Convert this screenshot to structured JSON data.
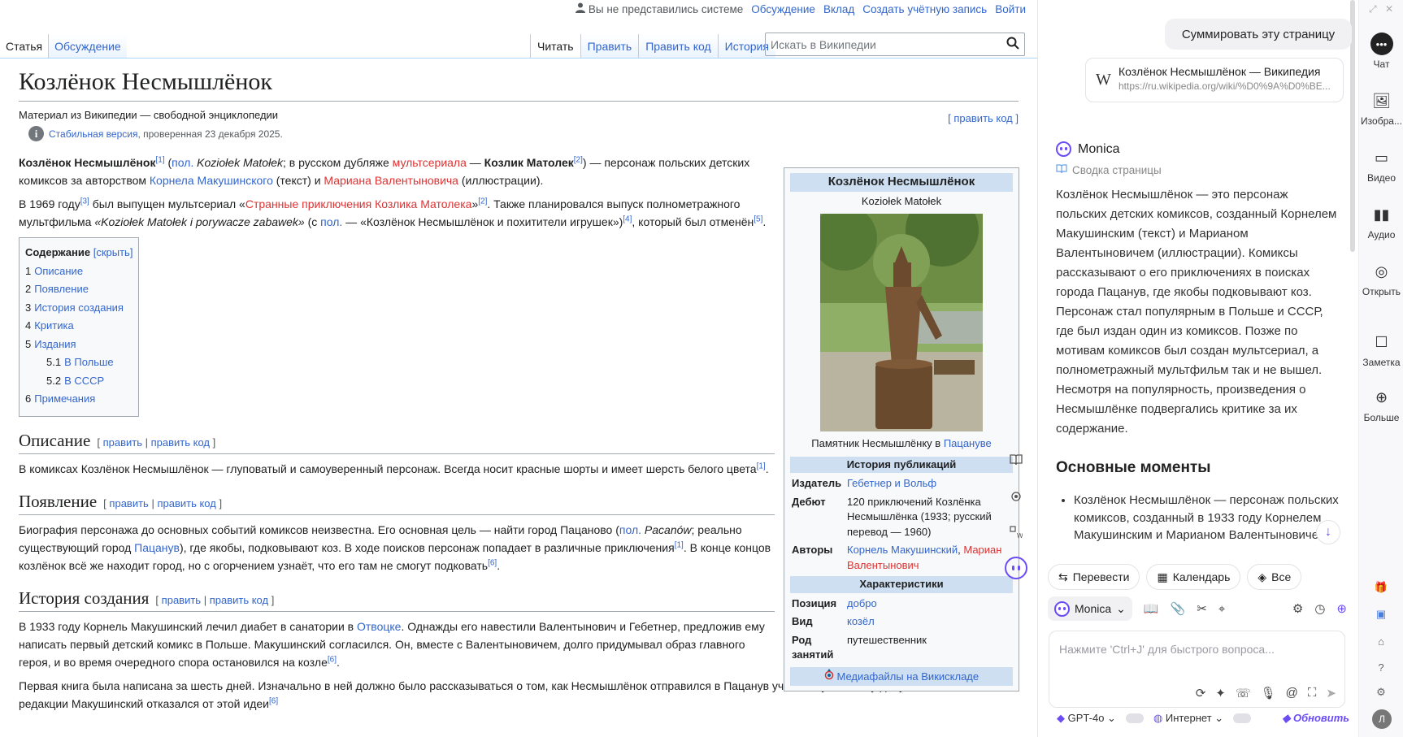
{
  "wiki": {
    "personal": {
      "anon": "Вы не представились системе",
      "talk": "Обсуждение",
      "contrib": "Вклад",
      "create": "Создать учётную запись",
      "login": "Войти"
    },
    "tabs_left": [
      "Статья",
      "Обсуждение"
    ],
    "tabs_right": [
      "Читать",
      "Править",
      "Править код",
      "История"
    ],
    "search_placeholder": "Искать в Википедии",
    "title": "Козлёнок Несмышлёнок",
    "tagline": "Материал из Википедии — свободной энциклопедии",
    "edit_code_top": "[ править код ]",
    "stable_link": "Стабильная версия",
    "stable_rest": ", проверенная 23 декабря 2025.",
    "lead1": {
      "bold1": "Козлёнок Несмышлёнок",
      "ref1": "[1]",
      "pl_link": "пол.",
      "pl_name": "Koziołek Matołek",
      "mid1": "; в русском дубляже ",
      "mult_link": "мультсериала",
      "dash": " — ",
      "bold2": "Козлик Матолек",
      "ref2": "[2]",
      "mid2": ") — персонаж польских детских комиксов за авторством ",
      "kornel": "Корнела Макушинского",
      "mid3": " (текст) и ",
      "marian": "Мариана Валентыновича",
      "end": " (иллюстрации)."
    },
    "lead2": {
      "a": "В 1969 году",
      "ref3": "[3]",
      "b": " был выпущен мультсериал «",
      "serial_link": "Странные приключения Козлика Матолека",
      "c": "»",
      "ref2": "[2]",
      "d": ". Также планировался выпуск полнометражного мультфильма ",
      "film": "«Koziołek Matołek i porywacze zabawek»",
      "e": " (с ",
      "pl": "пол.",
      "f": " — «Козлёнок Несмышлёнок и похитители игрушек»)",
      "ref4": "[4]",
      "g": ", который был отменён",
      "ref5": "[5]",
      "h": "."
    },
    "toc": {
      "title": "Содержание",
      "hide": "[скрыть]",
      "items": [
        {
          "n": "1",
          "label": "Описание"
        },
        {
          "n": "2",
          "label": "Появление"
        },
        {
          "n": "3",
          "label": "История создания"
        },
        {
          "n": "4",
          "label": "Критика"
        },
        {
          "n": "5",
          "label": "Издания"
        },
        {
          "n": "5.1",
          "label": "В Польше"
        },
        {
          "n": "5.2",
          "label": "В СССР"
        },
        {
          "n": "6",
          "label": "Примечания"
        }
      ]
    },
    "section_edit": {
      "open": "[",
      "edit": "править",
      "sep": "|",
      "code": "править код",
      "close": "]"
    },
    "s1": {
      "title": "Описание",
      "text": "В комиксах Козлёнок Несмышлёнок — глуповатый и самоуверенный персонаж. Всегда носит красные шорты и имеет шерсть белого цвета",
      "ref": "[1]",
      "end": "."
    },
    "s2": {
      "title": "Появление",
      "a": "Биография персонажа до основных событий комиксов неизвестна. Его основная цель — найти город Пацаново (",
      "pl": "пол.",
      "pl_name": "Pacanów",
      "b": "; реально существующий город ",
      "city": "Пацанув",
      "c": "), где якобы, подковывают коз. В ходе поисков персонаж попадает в различные приключения",
      "ref1": "[1]",
      "d": ". В конце концов козлёнок всё же находит город, но с огорчением узнаёт, что его там не смогут подковать",
      "ref6": "[6]",
      "e": "."
    },
    "s3": {
      "title": "История создания",
      "p1a": "В 1933 году Корнель Макушинский лечил диабет в санатории в ",
      "otw": "Отвоцке",
      "p1b": ". Однажды его навестили Валентынович и Гебетнер, предложив ему написать первый детский комикс в Польше. Макушинский согласился. Он, вместе с Валентыновичем, долго придумывал образ главного героя, и во время очередного спора остановился на козле",
      "ref6": "[6]",
      "p1c": ".",
      "p2": "Первая книга была написана за шесть дней. Изначально в ней должно было рассказываться о том, как Несмышлёнок отправился в Пацанув учиться кузнечному делу, но в окончательной редакции Макушинский отказался от этой идеи",
      "p2ref": "[6]"
    },
    "infobox": {
      "title": "Козлёнок Несмышлёнок",
      "subtitle": "Koziołek Matołek",
      "caption": "Памятник Несмышлёнку в ",
      "caption_link": "Пацануве",
      "pub_head": "История публикаций",
      "publisher_k": "Издатель",
      "publisher_v": "Гебетнер и Вольф",
      "debut_k": "Дебют",
      "debut_v": "120 приключений Козлёнка Несмышлёнка (1933; русский перевод — 1960)",
      "authors_k": "Авторы",
      "author1": "Корнель Макушинский",
      "author_sep": ", ",
      "author2": "Мариан Валентынович",
      "char_head": "Характеристики",
      "pos_k": "Позиция",
      "pos_v": "добро",
      "kind_k": "Вид",
      "kind_v": "козёл",
      "occ_k": "Род занятий",
      "occ_v": "путешественник",
      "commons": "Медиафайлы на Викискладе"
    }
  },
  "monica": {
    "summarize_btn": "Суммировать эту страницу",
    "page_title": "Козлёнок Несмышлёнок — Википедия",
    "page_url": "https://ru.wikipedia.org/wiki/%D0%9A%D0%BE...",
    "name": "Monica",
    "sub": "Сводка страницы",
    "summary": "Козлёнок Несмышлёнок — это персонаж польских детских комиксов, созданный Корнелем Макушинским (текст) и Марианом Валентыновичем (иллюстрации). Комиксы рассказывают о его приключениях в поисках города Пацанув, где якобы подковывают коз. Персонаж стал популярным в Польше и СССР, где был издан один из комиксов. Позже по мотивам комиксов был создан мультсериал, а полнометражный мультфильм так и не вышел. Несмотря на популярность, произведения о Несмышлёнке подвергались критике за их содержание.",
    "key_heading": "Основные моменты",
    "bullets": [
      "Козлёнок Несмышлёнок — персонаж польских комиксов, созданный в 1933 году Корнелем Макушинским и Марианом Валентыновичем."
    ],
    "chips": [
      "Перевести",
      "Календарь",
      "Все"
    ],
    "model_chip": "Monica",
    "input_placeholder": "Нажмите 'Ctrl+J' для быстрого вопроса...",
    "bottom": {
      "model": "GPT-4o",
      "internet": "Интернет",
      "upgrade": "Обновить"
    }
  },
  "rail": [
    "Чат",
    "Изобра...",
    "Видео",
    "Аудио",
    "Открыть",
    "Заметка",
    "Больше"
  ],
  "rail_avatar": "Л",
  "colors": {
    "link": "#3366cc",
    "redlink": "#dd3333",
    "monica_accent": "#6b4cf5",
    "infobox_head": "#cedff2"
  }
}
